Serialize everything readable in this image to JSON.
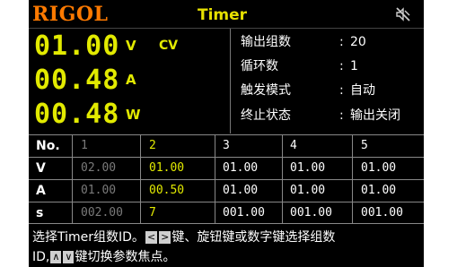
{
  "titlebar": {
    "logo": "RIGOL",
    "title": "Timer",
    "mute_icon": "speaker-mute-icon"
  },
  "measure": {
    "voltage": {
      "value": "01.00",
      "unit": "V"
    },
    "current": {
      "value": "00.48",
      "unit": "A"
    },
    "power": {
      "value": "00.48",
      "unit": "W"
    },
    "mode": "CV"
  },
  "info": [
    {
      "label": "输出组数",
      "value": "20"
    },
    {
      "label": "循环数",
      "value": "1"
    },
    {
      "label": "触发模式",
      "value": "自动"
    },
    {
      "label": "终止状态",
      "value": "输出关闭"
    }
  ],
  "info_colon": ":",
  "table": {
    "corner": "No.",
    "columns": [
      "1",
      "2",
      "3",
      "4",
      "5"
    ],
    "rows": [
      {
        "label": "V",
        "cells": [
          "02.00",
          "01.00",
          "01.00",
          "01.00",
          "01.00"
        ]
      },
      {
        "label": "A",
        "cells": [
          "01.00",
          "00.50",
          "01.00",
          "01.00",
          "01.00"
        ]
      },
      {
        "label": "s",
        "cells": [
          "002.00",
          "7",
          "001.00",
          "001.00",
          "001.00"
        ]
      }
    ]
  },
  "help": {
    "line1_before": "选择Timer组数ID。",
    "left_key": "<",
    "right_key": ">",
    "line1_after": "键、旋钮键或数字键选择组数",
    "line2_before": "ID,",
    "up_key": "∧",
    "down_key": "∨",
    "line2_after": "键切换参数焦点。"
  },
  "colors": {
    "accent": "#e2ea00",
    "logo": "#ff7a00",
    "dim": "#7a7a7a"
  }
}
